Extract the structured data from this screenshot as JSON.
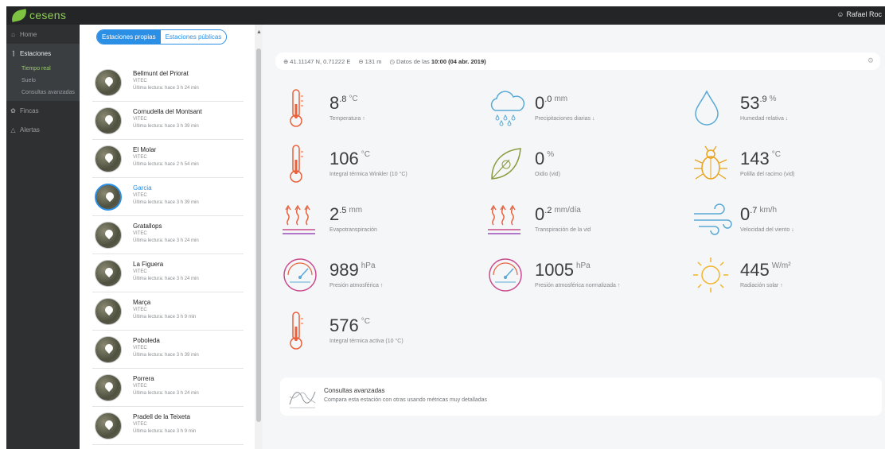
{
  "app": {
    "logo_text": "cesens",
    "user_name": "Rafael Roc"
  },
  "nav": {
    "home": "Home",
    "estaciones": "Estaciones",
    "sub": [
      "Tiempo real",
      "Suelo",
      "Consultas avanzadas"
    ],
    "fincas": "Fincas",
    "alertas": "Alertas"
  },
  "tabs": {
    "own": "Estaciones propias",
    "public": "Estaciones públicas"
  },
  "stations": [
    {
      "name": "Bellmunt del Priorat",
      "org": "VITEC",
      "reading": "Última lectura: hace 3 h 24 min"
    },
    {
      "name": "Cornudella del Montsant",
      "org": "VITEC",
      "reading": "Última lectura: hace 3 h 39 min"
    },
    {
      "name": "El Molar",
      "org": "VITEC",
      "reading": "Última lectura: hace 2 h 54 min"
    },
    {
      "name": "Garcia",
      "org": "VITEC",
      "reading": "Última lectura: hace 3 h 39 min"
    },
    {
      "name": "Gratallops",
      "org": "VITEC",
      "reading": "Última lectura: hace 3 h 24 min"
    },
    {
      "name": "La Figuera",
      "org": "VITEC",
      "reading": "Última lectura: hace 3 h 24 min"
    },
    {
      "name": "Marça",
      "org": "VITEC",
      "reading": "Última lectura: hace 3 h 9 min"
    },
    {
      "name": "Poboleda",
      "org": "VITEC",
      "reading": "Última lectura: hace 3 h 39 min"
    },
    {
      "name": "Porrera",
      "org": "VITEC",
      "reading": "Última lectura: hace 3 h 24 min"
    },
    {
      "name": "Pradell de la Teixeta",
      "org": "VITEC",
      "reading": "Última lectura: hace 3 h 9 min"
    }
  ],
  "info": {
    "coords": "41.11147 N, 0.71222 E",
    "altitude": "131 m",
    "data_prefix": "Datos de las",
    "data_time": "10:00 (04 abr. 2019)"
  },
  "metrics": {
    "temperatura": {
      "int": "8",
      "dec": ".8",
      "unit": "°C",
      "label": "Temperatura ↑"
    },
    "precipitaciones": {
      "int": "0",
      "dec": ".0",
      "unit": "mm",
      "label": "Precipitaciones diarias ↓"
    },
    "humedad": {
      "int": "53",
      "dec": ".9",
      "unit": "%",
      "label": "Humedad relativa ↓"
    },
    "winkler": {
      "int": "106",
      "dec": "",
      "unit": "°C",
      "label": "Integral térmica Winkler (10 °C)"
    },
    "oidio": {
      "int": "0",
      "dec": "",
      "unit": "%",
      "label": "Oidio (vid)"
    },
    "polilla": {
      "int": "143",
      "dec": "",
      "unit": "°C",
      "label": "Polilla del racimo (vid)"
    },
    "evapo": {
      "int": "2",
      "dec": ".5",
      "unit": "mm",
      "label": "Evapotranspiración"
    },
    "transpi": {
      "int": "0",
      "dec": ".2",
      "unit": "mm/día",
      "label": "Transpiración de la vid"
    },
    "viento": {
      "int": "0",
      "dec": ".7",
      "unit": "km/h",
      "label": "Velocidad del viento ↓"
    },
    "presion": {
      "int": "989",
      "dec": "",
      "unit": "hPa",
      "label": "Presión atmosférica ↑"
    },
    "presion_norm": {
      "int": "1005",
      "dec": "",
      "unit": "hPa",
      "label": "Presión atmosférica normalizada ↑"
    },
    "radiacion": {
      "int": "445",
      "dec": "",
      "unit": "W/m²",
      "label": "Radiación solar ↑"
    },
    "termica_activa": {
      "int": "576",
      "dec": "",
      "unit": "°C",
      "label": "Integral térmica activa (10 °C)"
    }
  },
  "advanced": {
    "title": "Consultas avanzadas",
    "desc": "Compara esta estación con otras usando métricas muy detalladas"
  }
}
